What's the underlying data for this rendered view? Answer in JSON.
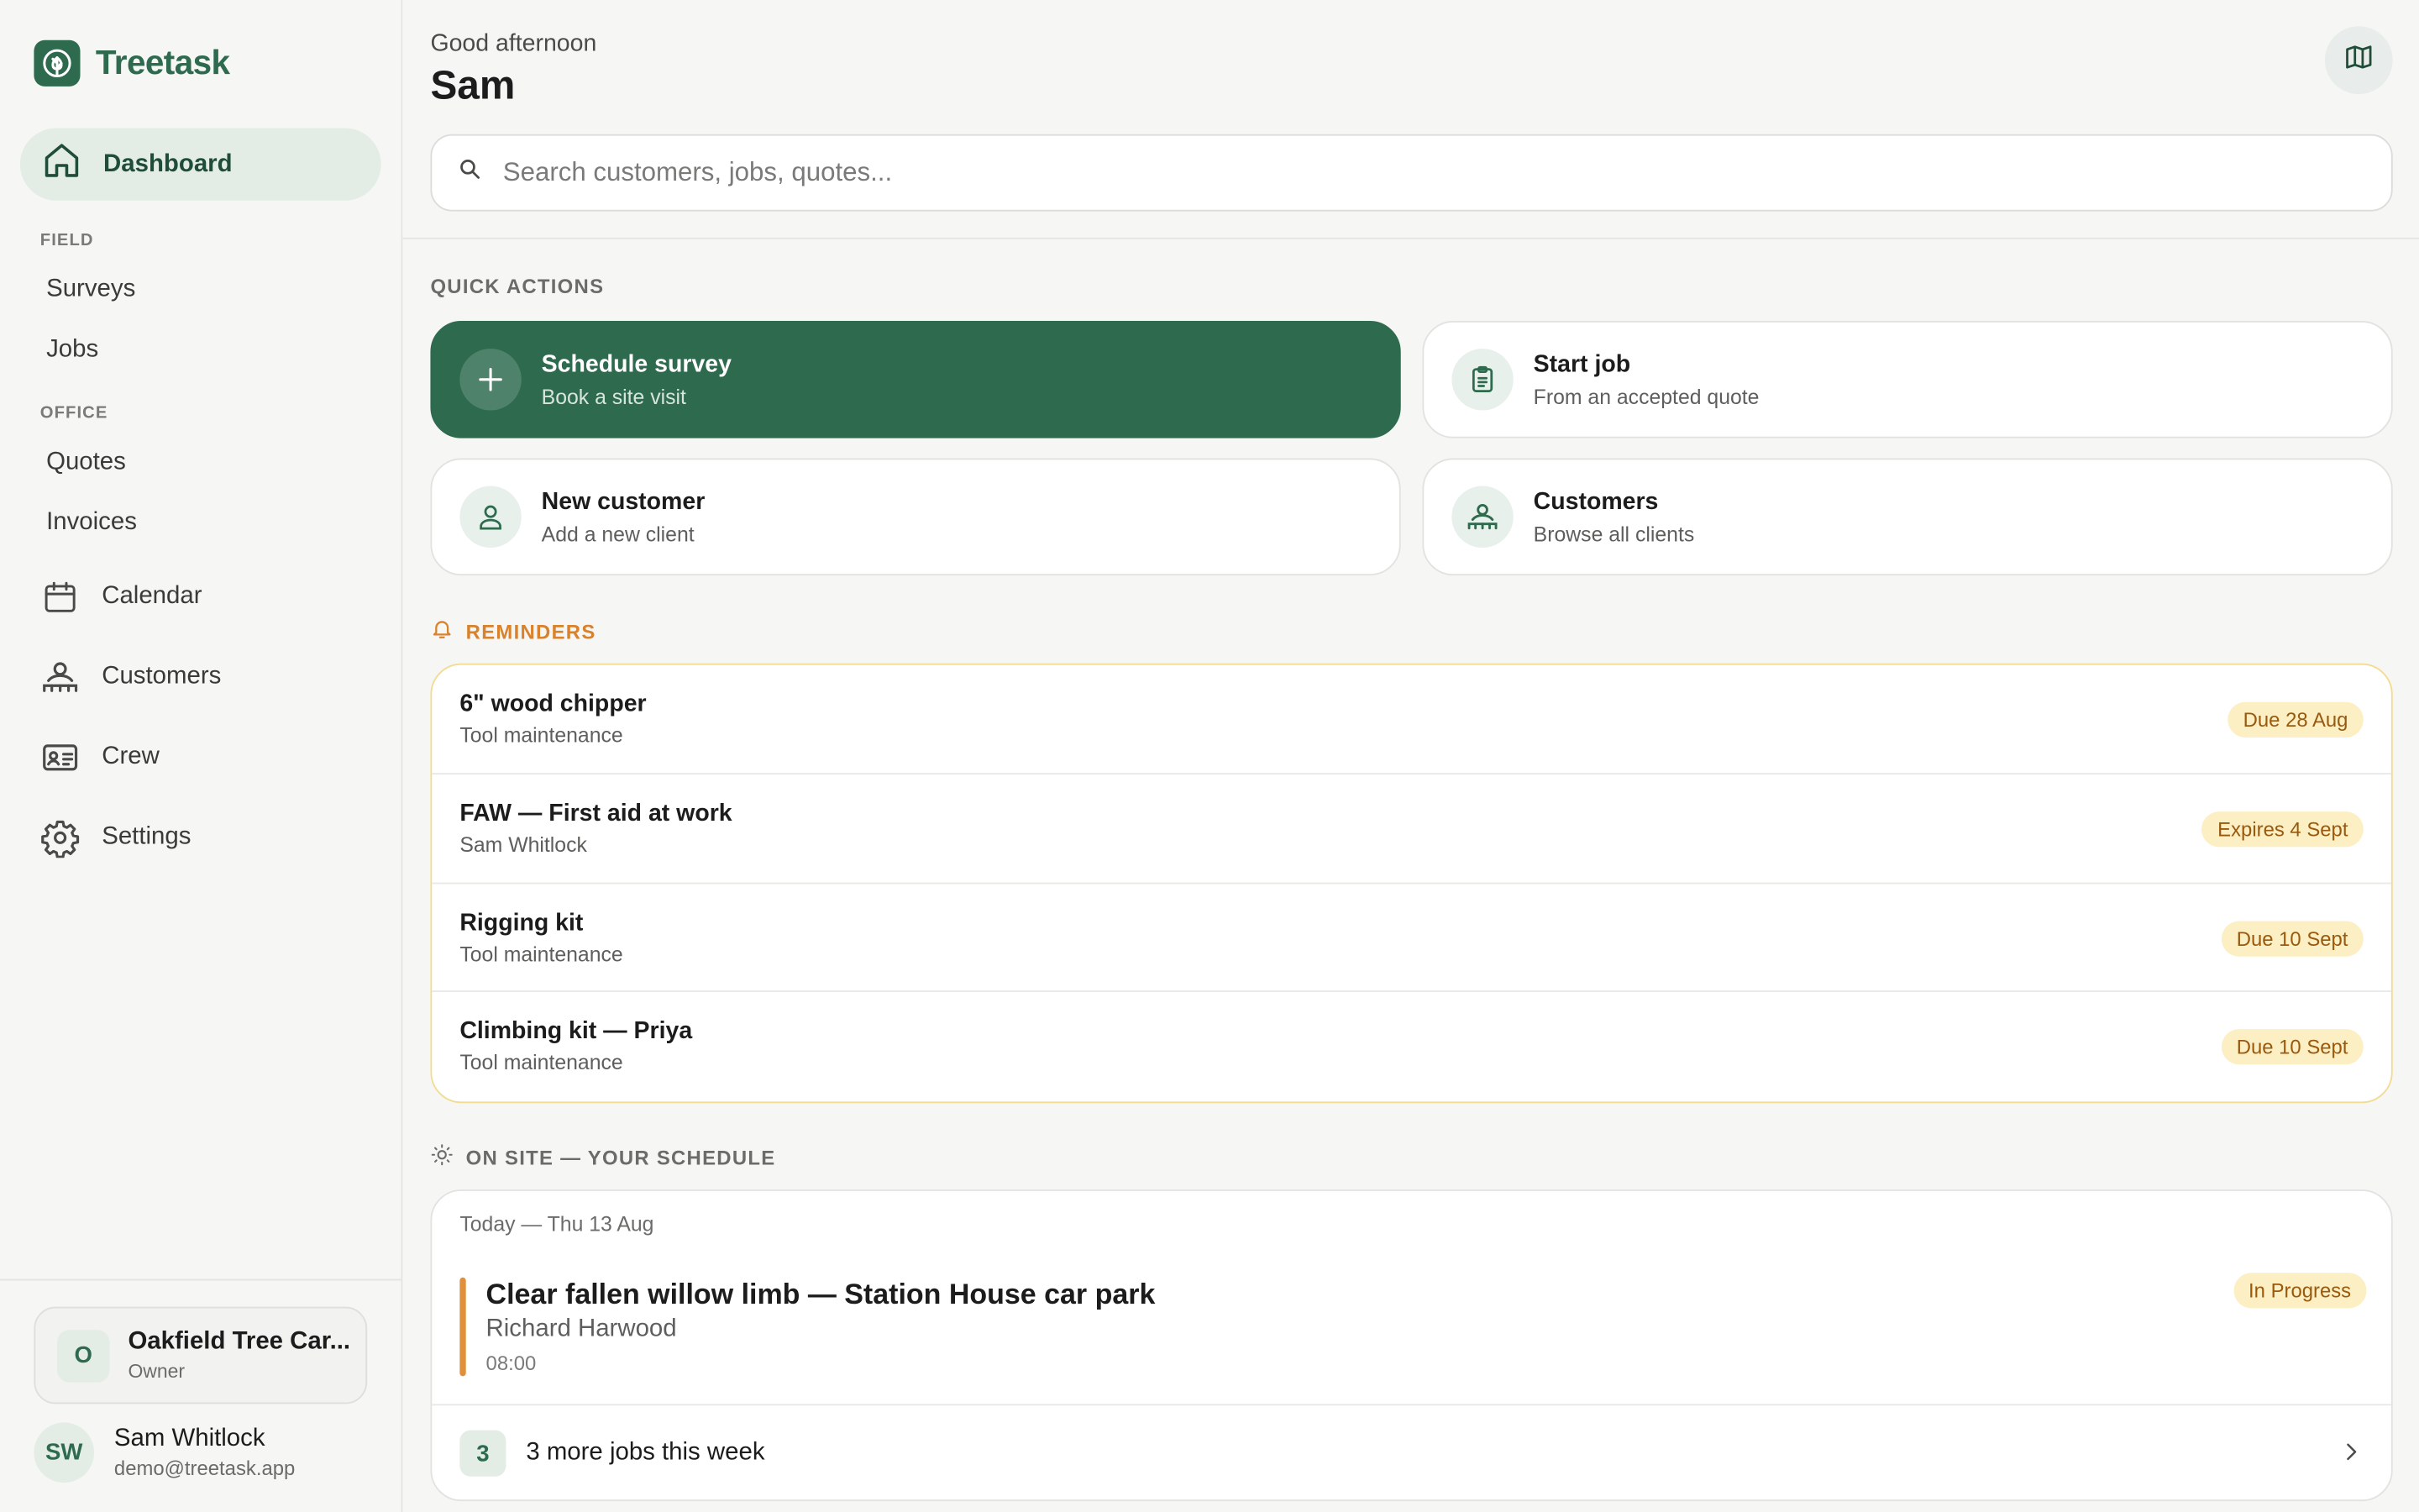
{
  "brand": {
    "name": "Treetask",
    "logo_icon": "leaf-icon",
    "color": "#2e6a4e"
  },
  "sidebar": {
    "dashboard": {
      "label": "Dashboard",
      "icon": "home-icon"
    },
    "sections": [
      {
        "title": "FIELD",
        "items": [
          "Surveys",
          "Jobs"
        ]
      },
      {
        "title": "OFFICE",
        "items": [
          "Quotes",
          "Invoices"
        ]
      }
    ],
    "items": [
      {
        "label": "Calendar",
        "icon": "calendar-icon"
      },
      {
        "label": "Customers",
        "icon": "customers-icon"
      },
      {
        "label": "Crew",
        "icon": "id-card-icon"
      },
      {
        "label": "Settings",
        "icon": "gear-icon"
      }
    ],
    "org": {
      "initial": "O",
      "name": "Oakfield Tree Car...",
      "role": "Owner"
    },
    "user": {
      "initials": "SW",
      "name": "Sam Whitlock",
      "email": "demo@treetask.app"
    }
  },
  "header": {
    "greeting": "Good afternoon",
    "name": "Sam",
    "map_icon": "map-icon",
    "search_placeholder": "Search customers, jobs, quotes..."
  },
  "quick_actions": {
    "title": "QUICK ACTIONS",
    "items": [
      {
        "title": "Schedule survey",
        "subtitle": "Book a site visit",
        "icon": "plus-icon",
        "primary": true
      },
      {
        "title": "Start job",
        "subtitle": "From an accepted quote",
        "icon": "clipboard-icon"
      },
      {
        "title": "New customer",
        "subtitle": "Add a new client",
        "icon": "user-icon"
      },
      {
        "title": "Customers",
        "subtitle": "Browse all clients",
        "icon": "customers-icon"
      }
    ]
  },
  "reminders": {
    "title": "REMINDERS",
    "accent": "#d9822b",
    "items": [
      {
        "title": "6\" wood chipper",
        "subtitle": "Tool maintenance",
        "badge": "Due 28 Aug"
      },
      {
        "title": "FAW — First aid at work",
        "subtitle": "Sam Whitlock",
        "badge": "Expires 4 Sept"
      },
      {
        "title": "Rigging kit",
        "subtitle": "Tool maintenance",
        "badge": "Due 10 Sept"
      },
      {
        "title": "Climbing kit — Priya",
        "subtitle": "Tool maintenance",
        "badge": "Due 10 Sept"
      }
    ]
  },
  "schedule": {
    "title": "ON SITE — YOUR SCHEDULE",
    "date": "Today — Thu 13 Aug",
    "job": {
      "title": "Clear fallen willow limb — Station House car park",
      "client": "Richard Harwood",
      "time": "08:00",
      "status": "In Progress"
    },
    "more": {
      "count": "3",
      "text": "3 more jobs this week"
    }
  }
}
